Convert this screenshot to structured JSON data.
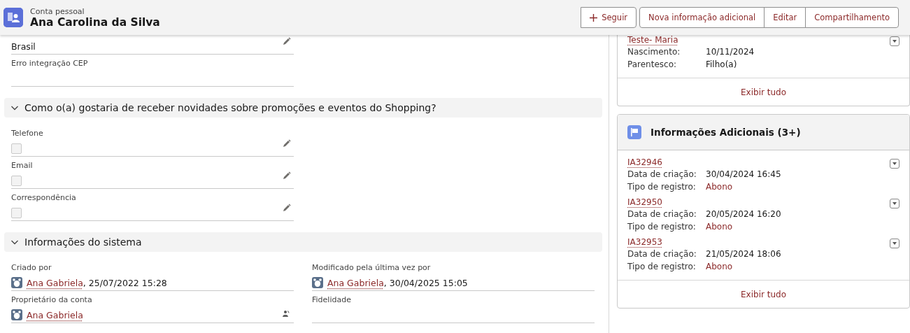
{
  "header": {
    "object_type": "Conta pessoal",
    "title": "Ana Carolina da Silva",
    "buttons": [
      {
        "label": "Seguir",
        "kind": "follow"
      },
      {
        "label": "Nova informação adicional",
        "kind": "plain"
      },
      {
        "label": "Editar",
        "kind": "plain"
      },
      {
        "label": "Compartilhamento",
        "kind": "plain"
      }
    ]
  },
  "details": {
    "top_fields": [
      {
        "value": "Brasil",
        "editable": true
      },
      {
        "label": "Erro integração CEP",
        "editable": false
      }
    ],
    "sections": [
      {
        "title": "Como o(a) gostaria de receber novidades sobre promoções e eventos do Shopping?",
        "expanded": true,
        "fields": [
          {
            "label": "Telefone",
            "kind": "checkbox",
            "checked": false,
            "editable": true
          },
          {
            "label": "Email",
            "kind": "checkbox",
            "checked": false,
            "editable": true
          },
          {
            "label": "Correspondência",
            "kind": "checkbox",
            "checked": false,
            "editable": true
          }
        ]
      },
      {
        "title": "Informações do sistema",
        "expanded": true,
        "grid": [
          {
            "label": "Criado por",
            "kind": "user",
            "user": "Ana Gabriela",
            "suffix": ", 25/07/2022 15:28"
          },
          {
            "label": "Modificado pela última vez por",
            "kind": "user",
            "user": "Ana Gabriela",
            "suffix": ", 30/04/2025 15:05"
          },
          {
            "label": "Proprietário da conta",
            "kind": "user",
            "user": "Ana Gabriela",
            "owner_change": true
          },
          {
            "label": "Fidelidade",
            "kind": "empty"
          }
        ]
      }
    ]
  },
  "related": [
    {
      "items": [
        {
          "name": "Teste- Maria",
          "rows": [
            {
              "label": "Nascimento:",
              "value": "10/11/2024",
              "link": false
            },
            {
              "label": "Parentesco:",
              "value": "Filho(a)",
              "link": false
            }
          ]
        }
      ],
      "footer": "Exibir tudo"
    },
    {
      "title": "Informações Adicionais (3+)",
      "items": [
        {
          "name": "IA32946",
          "rows": [
            {
              "label": "Data de criação:",
              "value": "30/04/2024 16:45",
              "link": false
            },
            {
              "label": "Tipo de registro:",
              "value": "Abono",
              "link": true
            }
          ]
        },
        {
          "name": "IA32950",
          "rows": [
            {
              "label": "Data de criação:",
              "value": "20/05/2024 16:20",
              "link": false
            },
            {
              "label": "Tipo de registro:",
              "value": "Abono",
              "link": true
            }
          ]
        },
        {
          "name": "IA32953",
          "rows": [
            {
              "label": "Data de criação:",
              "value": "21/05/2024 18:06",
              "link": false
            },
            {
              "label": "Tipo de registro:",
              "value": "Abono",
              "link": true
            }
          ]
        }
      ],
      "footer": "Exibir tudo"
    }
  ]
}
